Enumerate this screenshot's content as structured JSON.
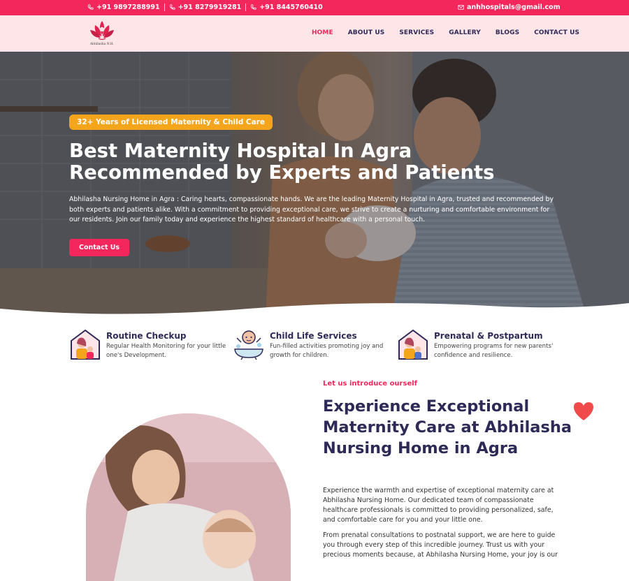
{
  "topbar": {
    "phones": [
      "+91 9897288991",
      "+91 8279919281",
      "+91 8445760410"
    ],
    "email": "anhhospitals@gmail.com",
    "icons": {
      "phone": "phone-icon",
      "email": "email-icon"
    }
  },
  "header": {
    "logo_text": "Abhilasha N.H.",
    "nav": [
      "HOME",
      "ABOUT US",
      "SERVICES",
      "GALLERY",
      "BLOGS",
      "CONTACT US"
    ],
    "active": "HOME"
  },
  "hero": {
    "badge": "32+ Years of Licensed Maternity & Child Care",
    "title": "Best Maternity Hospital In Agra Recommended by Experts and Patients",
    "description": "Abhilasha Nursing Home in Agra : Caring hearts, compassionate hands. We are the leading Maternity Hospital in Agra, trusted and recommended by both experts and patients alike. With a commitment to providing exceptional care, we strive to create a nurturing and comfortable environment for our residents. Join our family today and experience the highest standard of healthcare with a personal touch.",
    "button": "Contact Us"
  },
  "services": [
    {
      "title": "Routine Checkup",
      "desc": "Regular Health Monitoring for your little one's Development.",
      "icon": "family-house-icon"
    },
    {
      "title": "Child Life Services",
      "desc": "Fun-filled activities promoting joy and growth for children.",
      "icon": "baby-bath-icon"
    },
    {
      "title": "Prenatal & Postpartum",
      "desc": "Empowering programs for new parents' confidence and resilience.",
      "icon": "family-house-icon"
    }
  ],
  "about": {
    "eyebrow": "Let us introduce ourself",
    "title": "Experience Exceptional Maternity Care at Abhilasha Nursing Home in Agra",
    "p1": "Experience the warmth and expertise of exceptional maternity care at Abhilasha Nursing Home. Our dedicated team of compassionate healthcare professionals is committed to providing personalized, safe, and comfortable care for you and your little one.",
    "p2": "From prenatal consultations to postnatal support, we are here to guide you through every step of this incredible journey. Trust us with your precious moments because, at Abhilasha Nursing Home, your joy is our"
  },
  "colors": {
    "brand": "#f4275d",
    "navy": "#2e2a58",
    "badge": "#f4a51c",
    "header_bg": "#fde5e8"
  }
}
